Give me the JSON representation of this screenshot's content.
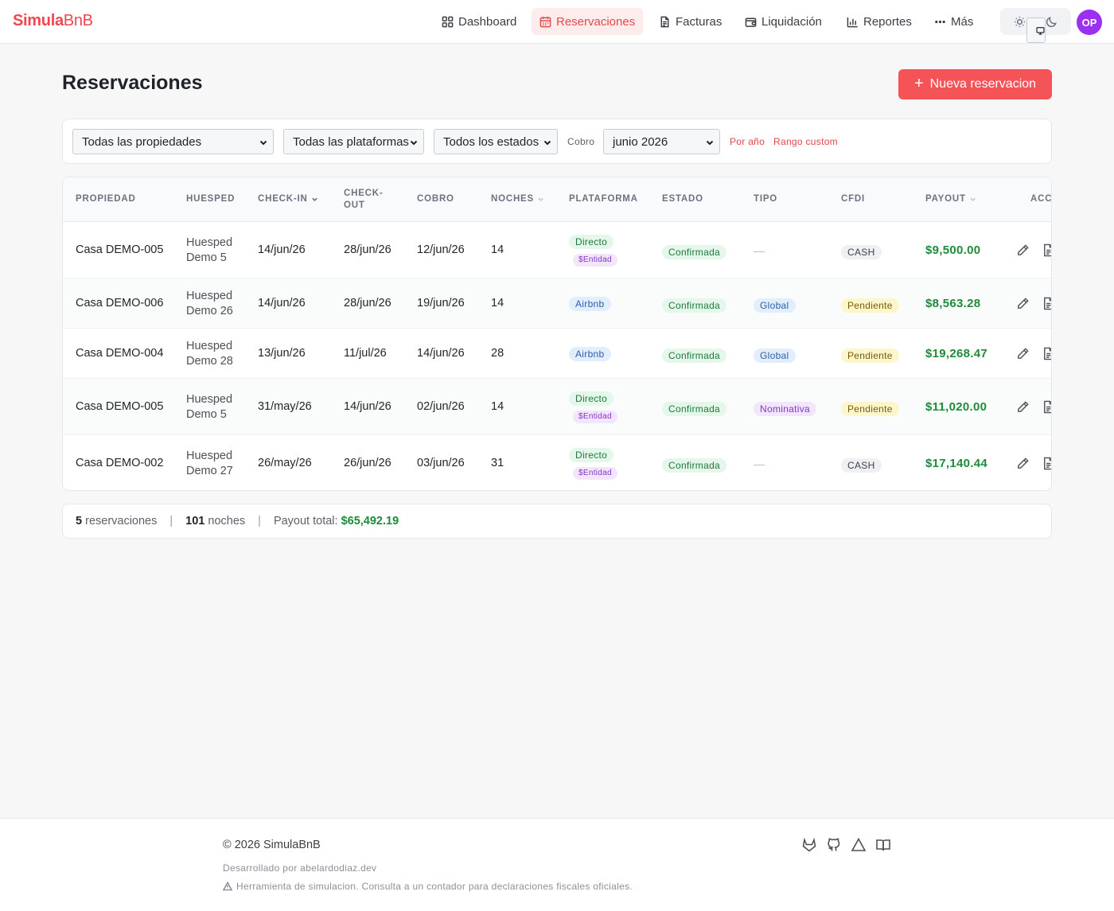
{
  "brand": {
    "part1": "Simula",
    "part2": "BnB"
  },
  "nav": [
    {
      "label": "Dashboard",
      "icon": "grid-icon"
    },
    {
      "label": "Reservaciones",
      "icon": "calendar-icon",
      "active": true
    },
    {
      "label": "Facturas",
      "icon": "document-icon"
    },
    {
      "label": "Liquidación",
      "icon": "wallet-icon"
    },
    {
      "label": "Reportes",
      "icon": "bar-chart-icon"
    },
    {
      "label": "Más",
      "icon": "more-icon"
    }
  ],
  "theme": {
    "options": [
      "sun-icon",
      "monitor-icon",
      "moon-icon"
    ],
    "selected": "monitor-icon"
  },
  "user": {
    "initials": "OP"
  },
  "page": {
    "title": "Reservaciones",
    "new_button": "Nueva reservacion"
  },
  "filters": {
    "property": "Todas las propiedades",
    "platform": "Todas las plataformas",
    "status": "Todos los estados",
    "cobro_label": "Cobro",
    "month": "junio 2026",
    "by_year": "Por año",
    "custom_range": "Rango custom"
  },
  "table": {
    "columns": [
      "Propiedad",
      "Huesped",
      "Check-in",
      "Check-out",
      "Cobro",
      "Noches",
      "Plataforma",
      "Estado",
      "Tipo",
      "CFDI",
      "Payout",
      "Acc"
    ],
    "rows": [
      {
        "property": "Casa DEMO-005",
        "guest1": "Huesped",
        "guest2": "Demo 5",
        "checkin": "14/jun/26",
        "checkout": "28/jun/26",
        "cobro": "12/jun/26",
        "nights": "14",
        "platform": "Directo",
        "platform_tag": "$Entidad",
        "status": "Confirmada",
        "tipo": "—",
        "cfdi": "CASH",
        "payout": "$9,500.00"
      },
      {
        "property": "Casa DEMO-006",
        "guest1": "Huesped",
        "guest2": "Demo 26",
        "checkin": "14/jun/26",
        "checkout": "28/jun/26",
        "cobro": "19/jun/26",
        "nights": "14",
        "platform": "Airbnb",
        "platform_tag": "",
        "status": "Confirmada",
        "tipo": "Global",
        "cfdi": "Pendiente",
        "payout": "$8,563.28"
      },
      {
        "property": "Casa DEMO-004",
        "guest1": "Huesped",
        "guest2": "Demo 28",
        "checkin": "13/jun/26",
        "checkout": "11/jul/26",
        "cobro": "14/jun/26",
        "nights": "28",
        "platform": "Airbnb",
        "platform_tag": "",
        "status": "Confirmada",
        "tipo": "Global",
        "cfdi": "Pendiente",
        "payout": "$19,268.47"
      },
      {
        "property": "Casa DEMO-005",
        "guest1": "Huesped",
        "guest2": "Demo 5",
        "checkin": "31/may/26",
        "checkout": "14/jun/26",
        "cobro": "02/jun/26",
        "nights": "14",
        "platform": "Directo",
        "platform_tag": "$Entidad",
        "status": "Confirmada",
        "tipo": "Nominativa",
        "cfdi": "Pendiente",
        "payout": "$11,020.00"
      },
      {
        "property": "Casa DEMO-002",
        "guest1": "Huesped",
        "guest2": "Demo 27",
        "checkin": "26/may/26",
        "checkout": "26/jun/26",
        "cobro": "03/jun/26",
        "nights": "31",
        "platform": "Directo",
        "platform_tag": "$Entidad",
        "status": "Confirmada",
        "tipo": "—",
        "cfdi": "CASH",
        "payout": "$17,140.44"
      }
    ]
  },
  "summary": {
    "count": "5",
    "count_label": "reservaciones",
    "nights": "101",
    "nights_label": "noches",
    "total_label": "Payout total:",
    "total": "$65,492.19"
  },
  "footer": {
    "copyright": "© 2026 SimulaBnB",
    "developer": "Desarrollado por abelardodiaz.dev",
    "disclaimer": "Herramienta de simulacion. Consulta a un contador para declaraciones fiscales oficiales.",
    "icons": [
      "gitlab-icon",
      "github-icon",
      "triangle-icon",
      "book-icon"
    ]
  },
  "colors": {
    "accent": "#f0464f",
    "payout": "#1f8a3b",
    "avatar": "#9b30f0"
  }
}
